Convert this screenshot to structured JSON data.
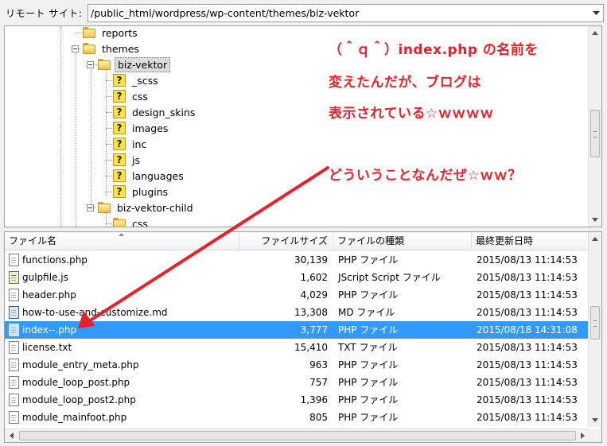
{
  "pathbar": {
    "label": "リモート サイト:",
    "path": "/public_html/wordpress/wp-content/themes/biz-vektor"
  },
  "tree": {
    "items": [
      {
        "label": "reports",
        "icon": "folder-icon"
      },
      {
        "label": "themes",
        "icon": "folder-open-icon"
      },
      {
        "label": "biz-vektor",
        "icon": "folder-open-icon",
        "selected": true
      },
      {
        "label": "_scss",
        "icon": "question-folder-icon"
      },
      {
        "label": "css",
        "icon": "question-folder-icon"
      },
      {
        "label": "design_skins",
        "icon": "question-folder-icon"
      },
      {
        "label": "images",
        "icon": "question-folder-icon"
      },
      {
        "label": "inc",
        "icon": "question-folder-icon"
      },
      {
        "label": "js",
        "icon": "question-folder-icon"
      },
      {
        "label": "languages",
        "icon": "question-folder-icon"
      },
      {
        "label": "plugins",
        "icon": "question-folder-icon"
      },
      {
        "label": "biz-vektor-child",
        "icon": "folder-open-icon"
      },
      {
        "label": "css",
        "icon": "folder-icon"
      }
    ],
    "scroll_fraction": 0.55
  },
  "annotations": {
    "line1": "（＾ｑ＾）index.php の名前を",
    "line2": "変えたんだが、ブログは",
    "line3": "表示されている☆ｗｗｗｗ",
    "line4": "どういうことなんだぜ☆ｗｗ？",
    "color": "#e8202a"
  },
  "list": {
    "columns": {
      "name": "ファイル名",
      "size": "ファイルサイズ",
      "type": "ファイルの種類",
      "modified": "最終更新日時"
    },
    "rows": [
      {
        "name": "functions.php",
        "size": "30,139",
        "type": "PHP ファイル",
        "modified": "2015/08/13 11:14:53",
        "icon": "php-file-icon"
      },
      {
        "name": "gulpfile.js",
        "size": "1,602",
        "type": "JScript Script ファイル",
        "modified": "2015/08/13 11:14:53",
        "icon": "js-file-icon"
      },
      {
        "name": "header.php",
        "size": "4,029",
        "type": "PHP ファイル",
        "modified": "2015/08/13 11:14:53",
        "icon": "php-file-icon"
      },
      {
        "name": "how-to-use-and-customize.md",
        "size": "13,308",
        "type": "MD ファイル",
        "modified": "2015/08/13 11:14:53",
        "icon": "md-file-icon"
      },
      {
        "name": "index--.php",
        "size": "3,777",
        "type": "PHP ファイル",
        "modified": "2015/08/18 14:31:08",
        "icon": "php-file-icon",
        "selected": true
      },
      {
        "name": "license.txt",
        "size": "15,410",
        "type": "TXT ファイル",
        "modified": "2015/08/13 11:14:53",
        "icon": "txt-file-icon"
      },
      {
        "name": "module_entry_meta.php",
        "size": "963",
        "type": "PHP ファイル",
        "modified": "2015/08/13 11:14:53",
        "icon": "php-file-icon"
      },
      {
        "name": "module_loop_post.php",
        "size": "757",
        "type": "PHP ファイル",
        "modified": "2015/08/13 11:14:53",
        "icon": "php-file-icon"
      },
      {
        "name": "module_loop_post2.php",
        "size": "1,396",
        "type": "PHP ファイル",
        "modified": "2015/08/13 11:14:53",
        "icon": "php-file-icon"
      },
      {
        "name": "module_mainfoot.php",
        "size": "805",
        "type": "PHP ファイル",
        "modified": "2015/08/13 11:14:53",
        "icon": "php-file-icon"
      }
    ],
    "scroll_fraction": 0.45
  }
}
